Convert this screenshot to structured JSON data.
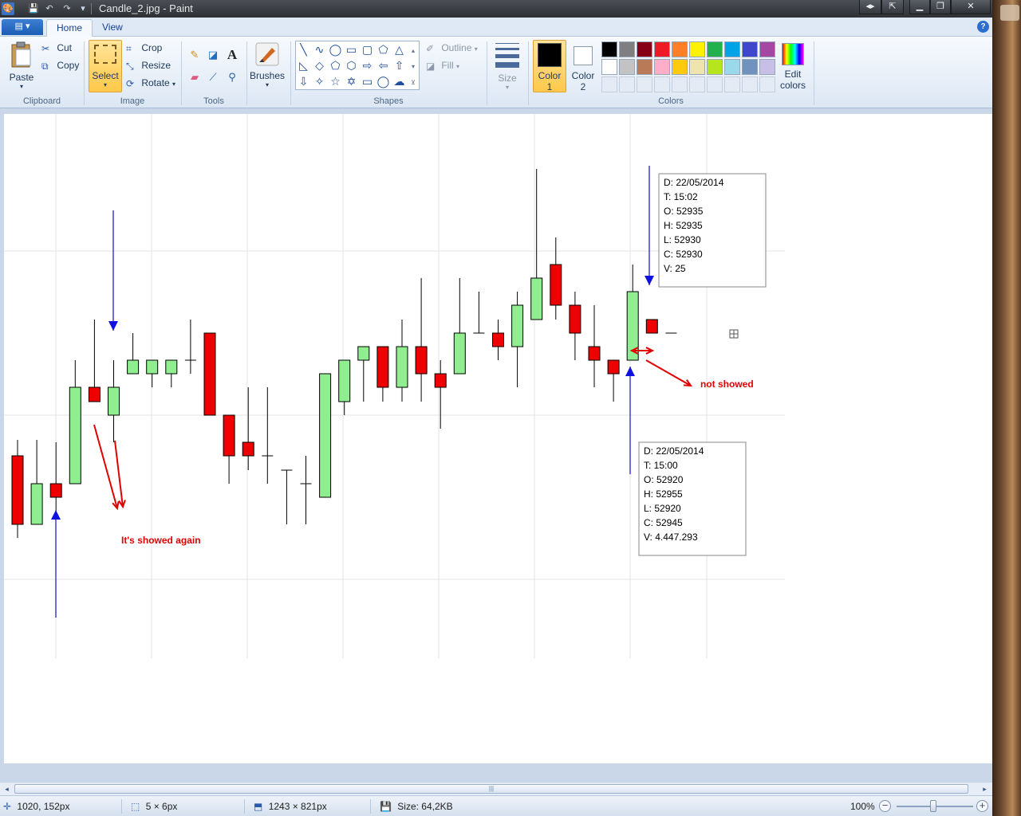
{
  "window": {
    "title": "Candle_2.jpg - Paint"
  },
  "tabs": {
    "home": "Home",
    "view": "View"
  },
  "ribbon": {
    "clipboard": {
      "label": "Clipboard",
      "paste": "Paste",
      "cut": "Cut",
      "copy": "Copy"
    },
    "image": {
      "label": "Image",
      "select": "Select",
      "crop": "Crop",
      "resize": "Resize",
      "rotate": "Rotate"
    },
    "tools": {
      "label": "Tools"
    },
    "brushes": {
      "label": "Brushes"
    },
    "shapes": {
      "label": "Shapes",
      "outline": "Outline",
      "fill": "Fill"
    },
    "size": {
      "label": "Size"
    },
    "colors": {
      "label": "Colors",
      "color1": "Color\n1",
      "color1_line1": "Color",
      "color1_line2": "1",
      "color2_line1": "Color",
      "color2_line2": "2",
      "edit_line1": "Edit",
      "edit_line2": "colors",
      "palette_row1": [
        "#000000",
        "#7f7f7f",
        "#880015",
        "#ed1c24",
        "#ff7f27",
        "#fff200",
        "#22b14c",
        "#00a2e8",
        "#3f48cc",
        "#a349a4"
      ],
      "palette_row2": [
        "#ffffff",
        "#c3c3c3",
        "#b97a57",
        "#ffaec9",
        "#ffc90e",
        "#efe4b0",
        "#b5e61d",
        "#99d9ea",
        "#7092be",
        "#c8bfe7"
      ]
    }
  },
  "canvas": {
    "tooltip1": [
      "D: 22/05/2014",
      "T: 15:02",
      "O: 52935",
      "H: 52935",
      "L: 52930",
      "C: 52930",
      "V: 25"
    ],
    "tooltip2": [
      "D: 22/05/2014",
      "T: 15:00",
      "O: 52920",
      "H: 52955",
      "L: 52920",
      "C: 52945",
      "V: 4.447.293"
    ],
    "note_left": "It's showed again",
    "note_right": "not showed",
    "candles": [
      {
        "c": "r",
        "hi": 552,
        "lo": 675,
        "o": 572,
        "cl": 658
      },
      {
        "c": "g",
        "hi": 552,
        "lo": 658,
        "o": 658,
        "cl": 607
      },
      {
        "c": "r",
        "hi": 555,
        "lo": 650,
        "o": 607,
        "cl": 624
      },
      {
        "c": "g",
        "hi": 452,
        "lo": 607,
        "o": 607,
        "cl": 486
      },
      {
        "c": "r",
        "hi": 401,
        "lo": 504,
        "o": 486,
        "cl": 504
      },
      {
        "c": "g",
        "hi": 452,
        "lo": 555,
        "o": 521,
        "cl": 486
      },
      {
        "c": "g",
        "hi": 418,
        "lo": 469,
        "o": 469,
        "cl": 452
      },
      {
        "c": "g",
        "hi": 452,
        "lo": 486,
        "o": 469,
        "cl": 452
      },
      {
        "c": "g",
        "hi": 452,
        "lo": 486,
        "o": 469,
        "cl": 452
      },
      {
        "c": "d",
        "hi": 401,
        "lo": 469,
        "o": 452,
        "cl": 452
      },
      {
        "c": "r",
        "hi": 418,
        "lo": 521,
        "o": 418,
        "cl": 521
      },
      {
        "c": "r",
        "hi": 521,
        "lo": 607,
        "o": 521,
        "cl": 572
      },
      {
        "c": "r",
        "hi": 486,
        "lo": 590,
        "o": 555,
        "cl": 572
      },
      {
        "c": "d",
        "hi": 486,
        "lo": 607,
        "o": 572,
        "cl": 572
      },
      {
        "c": "d",
        "hi": 590,
        "lo": 658,
        "o": 590,
        "cl": 590
      },
      {
        "c": "d",
        "hi": 572,
        "lo": 658,
        "o": 607,
        "cl": 607
      },
      {
        "c": "g",
        "hi": 469,
        "lo": 624,
        "o": 624,
        "cl": 469
      },
      {
        "c": "g",
        "hi": 452,
        "lo": 521,
        "o": 504,
        "cl": 452
      },
      {
        "c": "g",
        "hi": 435,
        "lo": 504,
        "o": 452,
        "cl": 435
      },
      {
        "c": "r",
        "hi": 435,
        "lo": 504,
        "o": 435,
        "cl": 486
      },
      {
        "c": "g",
        "hi": 401,
        "lo": 504,
        "o": 486,
        "cl": 435
      },
      {
        "c": "r",
        "hi": 349,
        "lo": 504,
        "o": 435,
        "cl": 469
      },
      {
        "c": "r",
        "hi": 452,
        "lo": 538,
        "o": 469,
        "cl": 486
      },
      {
        "c": "g",
        "hi": 349,
        "lo": 469,
        "o": 469,
        "cl": 418
      },
      {
        "c": "d",
        "hi": 366,
        "lo": 418,
        "o": 418,
        "cl": 418
      },
      {
        "c": "r",
        "hi": 401,
        "lo": 452,
        "o": 418,
        "cl": 435
      },
      {
        "c": "g",
        "hi": 366,
        "lo": 486,
        "o": 435,
        "cl": 383
      },
      {
        "c": "g",
        "hi": 212,
        "lo": 401,
        "o": 401,
        "cl": 349
      },
      {
        "c": "r",
        "hi": 298,
        "lo": 401,
        "o": 332,
        "cl": 383
      },
      {
        "c": "r",
        "hi": 366,
        "lo": 452,
        "o": 383,
        "cl": 418
      },
      {
        "c": "r",
        "hi": 383,
        "lo": 486,
        "o": 435,
        "cl": 452
      },
      {
        "c": "r",
        "hi": 452,
        "lo": 504,
        "o": 452,
        "cl": 469
      },
      {
        "c": "g",
        "hi": 332,
        "lo": 452,
        "o": 452,
        "cl": 366
      },
      {
        "c": "r",
        "hi": 401,
        "lo": 418,
        "o": 401,
        "cl": 418
      },
      {
        "c": "d",
        "hi": 418,
        "lo": 418,
        "o": 418,
        "cl": 418
      }
    ]
  },
  "status": {
    "cursor_pos": "1020, 152px",
    "selection_size": "5 × 6px",
    "image_size": "1243 × 821px",
    "file_size": "Size: 64,2KB",
    "zoom": "100%"
  }
}
